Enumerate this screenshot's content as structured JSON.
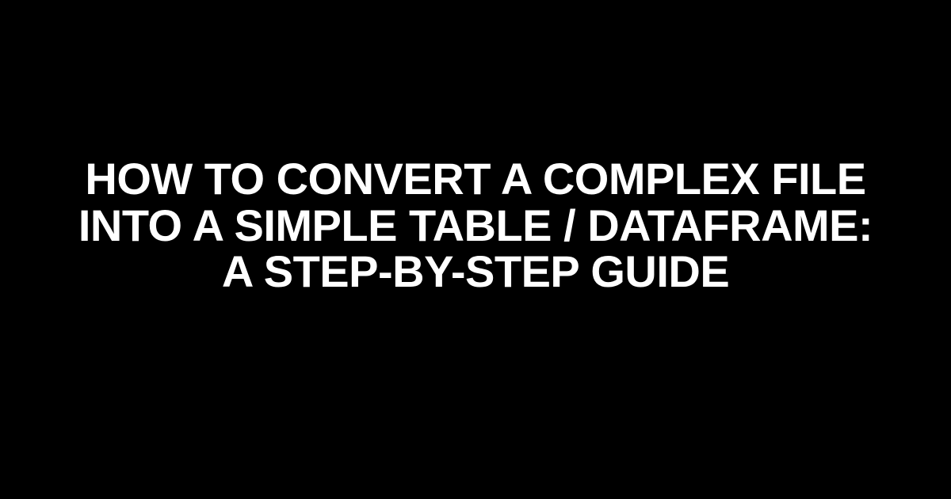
{
  "title": "HOW TO CONVERT A COMPLEX FILE INTO A SIMPLE TABLE / DATAFRAME: A STEP-BY-STEP GUIDE"
}
